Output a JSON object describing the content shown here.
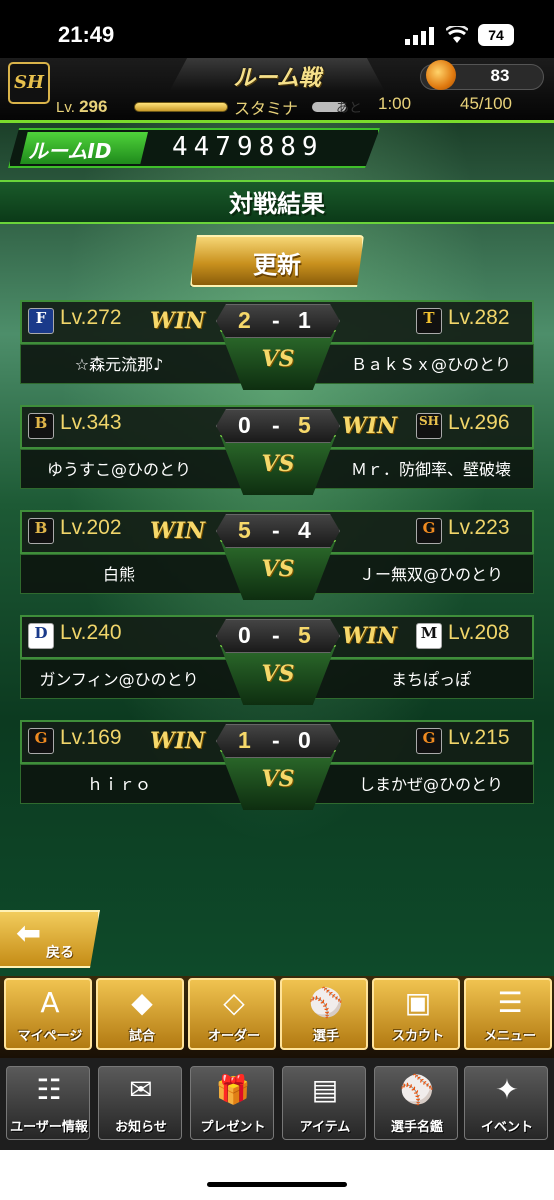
{
  "status_bar": {
    "time": "21:49",
    "battery": "74"
  },
  "header": {
    "team_logo": "SH",
    "title": "ルーム戦",
    "coins": "83",
    "level": "296",
    "level_prefix": "Lv.",
    "stamina_label": "スタミナ",
    "remaining_label": "あと",
    "remaining_time": "1:00",
    "stamina_value": "45/100"
  },
  "room": {
    "label": "ルームID",
    "value": "4479889"
  },
  "results": {
    "title": "対戦結果",
    "refresh_label": "更新",
    "vs_label": "VS",
    "win_label": "WIN",
    "matches": [
      {
        "left_icon": "F",
        "left_level": "Lv.272",
        "left_name": "☆森元流那♪",
        "left_score": "2",
        "right_score": "1",
        "right_icon": "T",
        "right_level": "Lv.282",
        "right_name": "ＢａｋＳｘ@ひのとり",
        "winner": "left"
      },
      {
        "left_icon": "B",
        "left_level": "Lv.343",
        "left_name": "ゆうすこ@ひのとり",
        "left_score": "0",
        "right_score": "5",
        "right_icon": "SH",
        "right_level": "Lv.296",
        "right_name": "Ｍｒ．防御率、壁破壊",
        "winner": "right"
      },
      {
        "left_icon": "B",
        "left_level": "Lv.202",
        "left_name": "白熊",
        "left_score": "5",
        "right_score": "4",
        "right_icon": "G",
        "right_level": "Lv.223",
        "right_name": "Ｊー無双@ひのとり",
        "winner": "left"
      },
      {
        "left_icon": "D",
        "left_level": "Lv.240",
        "left_name": "ガンフィン@ひのとり",
        "left_score": "0",
        "right_score": "5",
        "right_icon": "M",
        "right_level": "Lv.208",
        "right_name": "まちぽっぽ",
        "winner": "right"
      },
      {
        "left_icon": "G",
        "left_level": "Lv.169",
        "left_name": "ｈｉｒｏ",
        "left_score": "1",
        "right_score": "0",
        "right_icon": "G",
        "right_level": "Lv.215",
        "right_name": "しまかぜ@ひのとり",
        "winner": "left"
      }
    ]
  },
  "back_label": "戻る",
  "nav_primary": [
    {
      "label": "マイページ",
      "icon": "A"
    },
    {
      "label": "試合",
      "icon": "◆"
    },
    {
      "label": "オーダー",
      "icon": "◇"
    },
    {
      "label": "選手",
      "icon": "⚾"
    },
    {
      "label": "スカウト",
      "icon": "▣"
    },
    {
      "label": "メニュー",
      "icon": "☰"
    }
  ],
  "nav_secondary": [
    {
      "label": "ユーザー情報",
      "icon": "☷"
    },
    {
      "label": "お知らせ",
      "icon": "✉"
    },
    {
      "label": "プレゼント",
      "icon": "🎁"
    },
    {
      "label": "アイテム",
      "icon": "▤"
    },
    {
      "label": "選手名鑑",
      "icon": "⚾"
    },
    {
      "label": "イベント",
      "icon": "✦"
    }
  ],
  "colors": {
    "accent_green": "#3fbf2a",
    "gold": "#f0d56a",
    "win_gold": "#f6d86a"
  }
}
